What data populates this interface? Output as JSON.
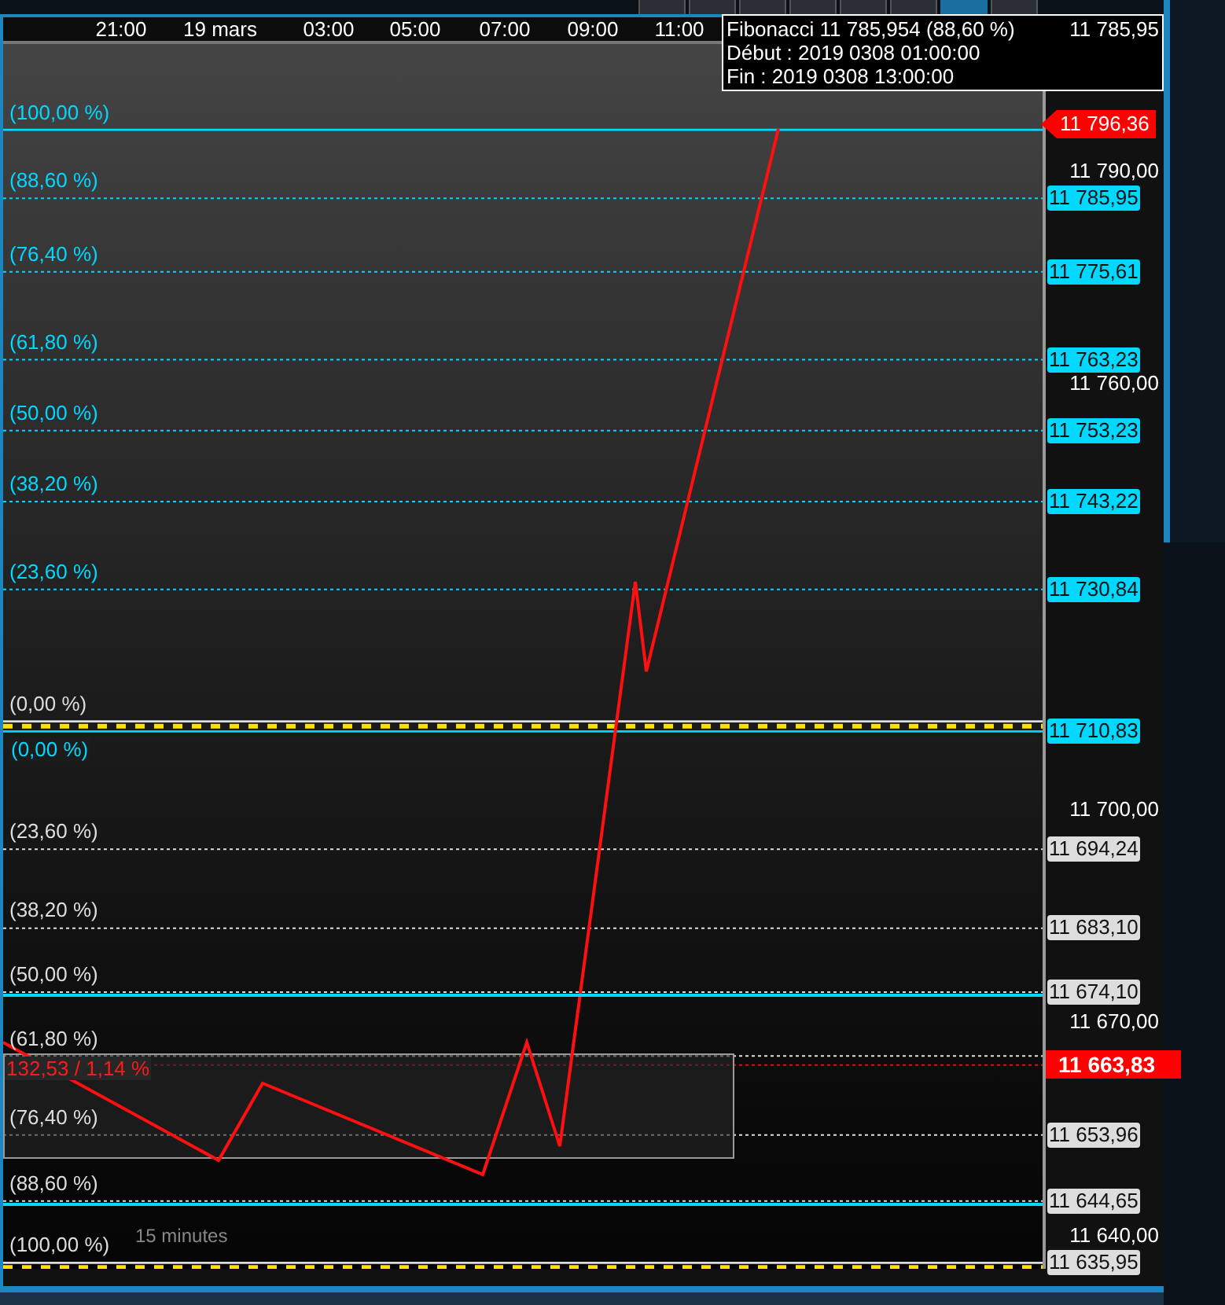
{
  "toolbar": {
    "buttons": [
      {
        "selected": false
      },
      {
        "selected": false
      },
      {
        "selected": false
      },
      {
        "selected": false
      },
      {
        "selected": false
      },
      {
        "selected": false
      },
      {
        "selected": true
      },
      {
        "selected": false
      }
    ]
  },
  "tooltip": {
    "lines": [
      "Fibonacci 11 785,954 (88,60 %)",
      "Début : 2019 0308 01:00:00",
      "Fin : 2019 0308 13:00:00"
    ],
    "value": "11 785,95"
  },
  "time_axis": {
    "labels": [
      "21:00",
      "19 mars",
      "03:00",
      "05:00",
      "07:00",
      "09:00",
      "11:00"
    ]
  },
  "price_axis": {
    "labels": [
      "11 790,00",
      "11 760,00",
      "11 700,00",
      "11 670,00",
      "11 640,00"
    ]
  },
  "fibonacci": [
    {
      "color": "#00d8ff",
      "levels": [
        {
          "label": "(100,00 %)"
        },
        {
          "label": "(88,60 %)",
          "price": "11 785,95"
        },
        {
          "label": "(76,40 %)",
          "price": "11 775,61"
        },
        {
          "label": "(61,80 %)",
          "price": "11 763,23"
        },
        {
          "label": "(50,00 %)",
          "price": "11 753,23"
        },
        {
          "label": "(38,20 %)",
          "price": "11 743,22"
        },
        {
          "label": "(23,60 %)",
          "price": "11 730,84"
        },
        {
          "label": "(0,00 %)",
          "price": "11 710,83"
        }
      ]
    },
    {
      "color": "#dddddd",
      "levels": [
        {
          "label": "(0,00 %)"
        },
        {
          "label": "(23,60 %)",
          "price": "11 694,24"
        },
        {
          "label": "(38,20 %)",
          "price": "11 683,10"
        },
        {
          "label": "(50,00 %)",
          "price": "11 674,10",
          "cyan_line": true
        },
        {
          "label": "(61,80 %)"
        },
        {
          "label": "(76,40 %)",
          "price": "11 653,96"
        },
        {
          "label": "(88,60 %)",
          "price": "11 644,65",
          "cyan_line": true
        },
        {
          "label": "(100,00 %)",
          "price": "11 635,95"
        }
      ]
    }
  ],
  "last_price": "11 796,36",
  "measure": {
    "label": "132,53 / 1,14 %",
    "price": "11 663,83"
  },
  "interval": "15 minutes"
}
